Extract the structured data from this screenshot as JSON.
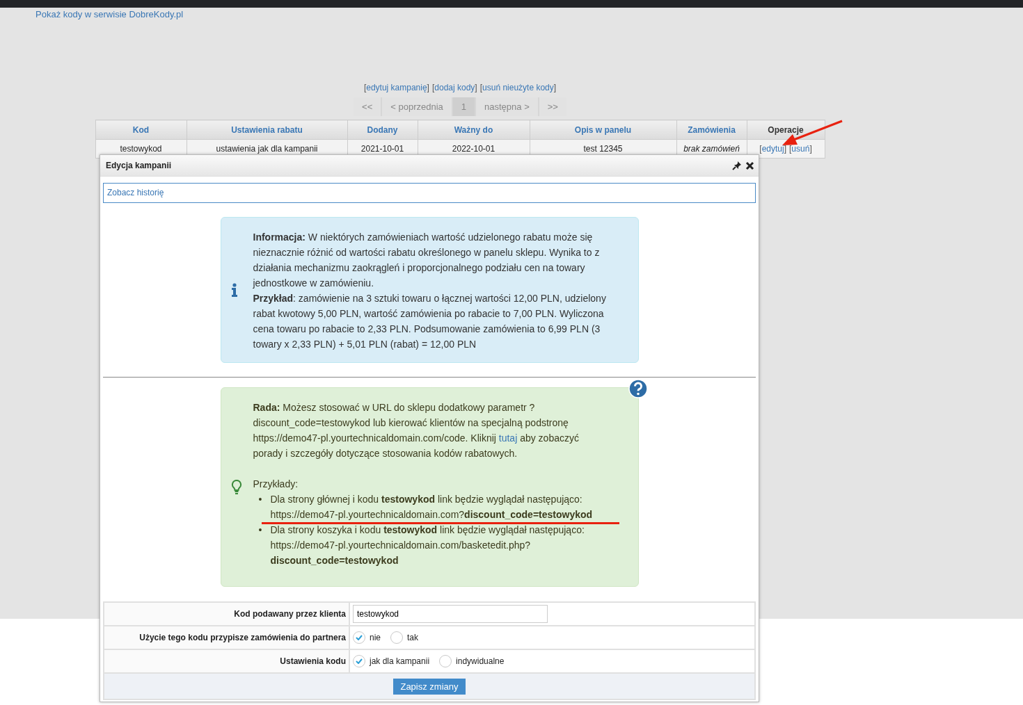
{
  "top_link": "Pokaż kody w serwisie DobreKody.pl",
  "actions": [
    {
      "open": "[",
      "label": "edytuj kampanię",
      "close": "]"
    },
    {
      "open": "[",
      "label": "dodaj kody",
      "close": "]"
    },
    {
      "open": "[",
      "label": "usuń nieużyte kody",
      "close": "]"
    }
  ],
  "pager": [
    {
      "label": "<<",
      "selected": false
    },
    {
      "label": "< poprzednia",
      "selected": false
    },
    {
      "label": "1",
      "selected": true
    },
    {
      "label": "następna >",
      "selected": false
    },
    {
      "label": ">>",
      "selected": false
    }
  ],
  "table": {
    "columns": [
      {
        "label": "Kod",
        "sortable": true
      },
      {
        "label": "Ustawienia rabatu",
        "sortable": true
      },
      {
        "label": "Dodany",
        "sortable": true
      },
      {
        "label": "Ważny do",
        "sortable": true
      },
      {
        "label": "Opis w panelu",
        "sortable": true
      },
      {
        "label": "Zamówienia",
        "sortable": true
      },
      {
        "label": "Operacje",
        "sortable": false
      }
    ],
    "rows": [
      {
        "cells": [
          {
            "text": "testowykod",
            "kind": "plain"
          },
          {
            "text": "ustawienia jak dla kampanii",
            "kind": "plain"
          },
          {
            "text": "2021-10-01",
            "kind": "plain"
          },
          {
            "text": "2022-10-01",
            "kind": "plain"
          },
          {
            "text": "test 12345",
            "kind": "plain"
          },
          {
            "text": "brak zamówień",
            "kind": "note"
          }
        ],
        "operations": [
          {
            "open": "[",
            "label": "edytuj",
            "close": "]"
          },
          {
            "open": "[",
            "label": "usuń",
            "close": "]"
          }
        ]
      }
    ]
  },
  "dialog": {
    "title": "Edycja kampanii",
    "history_link": "Zobacz historię",
    "info": [
      "**Informacja:** W niektórych zamówieniach wartość udzielonego rabatu może się nieznacznie różnić od wartości rabatu określonego w panelu sklepu. Wynika to z działania mechanizmu zaokrągleń i proporcjonalnego podziału cen na towary jednostkowe w zamówieniu.",
      "**Przykład**: zamówienie na 3 sztuki towaru o łącznej wartości 12,00 PLN, udzielony rabat kwotowy 5,00 PLN, wartość zamówienia po rabacie to 7,00 PLN. Wyliczona cena towaru po rabacie to 2,33 PLN. Podsumowanie zamówienia to 6,99 PLN (3 towary x 2,33 PLN) + 5,01 PLN (rabat) = 12,00 PLN"
    ],
    "tip": {
      "before": "**Rada:** Możesz stosować w URL do sklepu dodatkowy parametr ? discount_code=testowykod lub kierować klientów na specjalną podstronę https://demo47-pl.yourtechnicaldomain.com/code. Kliknij",
      "link": "tutaj",
      "after": "aby zobaczyć porady i szczegóły dotyczące stosowania kodów rabatowych.",
      "examples_label": "Przykłady:",
      "examples": [
        {
          "bullet": "•",
          "text": "Dla strony głównej i kodu **testowykod** link będzie wyglądał następująco:",
          "url": [
            "https://demo47-pl.yourtechnicaldomain.com?**discount_code=testowykod**"
          ],
          "underlined": true
        },
        {
          "bullet": "•",
          "text": "Dla strony koszyka i kodu **testowykod** link będzie wyglądał następująco:",
          "url": [
            "https://demo47-pl.yourtechnicaldomain.com/basketedit.php?",
            "**discount_code=testowykod**"
          ],
          "underlined": false
        }
      ]
    },
    "form": [
      {
        "label": "Kod podawany przez klienta",
        "kind": "text",
        "value": "testowykod"
      },
      {
        "label": "Użycie tego kodu przypisze zamówienia do partnera",
        "kind": "radio",
        "options": [
          {
            "label": "nie",
            "selected": true
          },
          {
            "label": "tak",
            "selected": false
          }
        ]
      },
      {
        "label": "Ustawienia kodu",
        "kind": "radio",
        "options": [
          {
            "label": "jak dla kampanii",
            "selected": true
          },
          {
            "label": "indywidualne",
            "selected": false
          }
        ]
      }
    ],
    "submit": "Zapisz zmiany"
  }
}
